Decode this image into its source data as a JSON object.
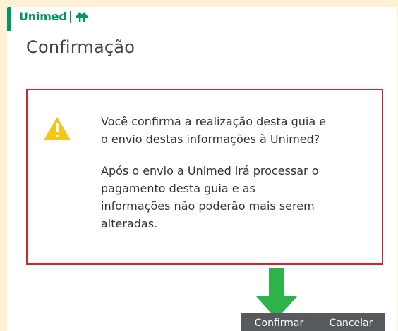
{
  "brand": {
    "name": "Unimed",
    "color": "#00995d",
    "logo_icon": "unimed-tree-icon"
  },
  "dialog": {
    "title": "Confirmação",
    "alert": {
      "icon": "warning-icon",
      "border_color": "#d1252b",
      "line1": "Você confirma a realização desta guia e",
      "line2": "o envio destas informações à Unimed?",
      "line3": "Após o envio a Unimed irá processar o",
      "line4": "pagamento desta guia e as",
      "line5": "informações não poderão mais serem",
      "line6": "alteradas."
    },
    "annotation": {
      "icon": "green-arrow-down-icon",
      "color": "#2db34a"
    },
    "buttons": {
      "confirm_label": "Confirmar",
      "cancel_label": "Cancelar",
      "color": "#565a5c"
    }
  }
}
